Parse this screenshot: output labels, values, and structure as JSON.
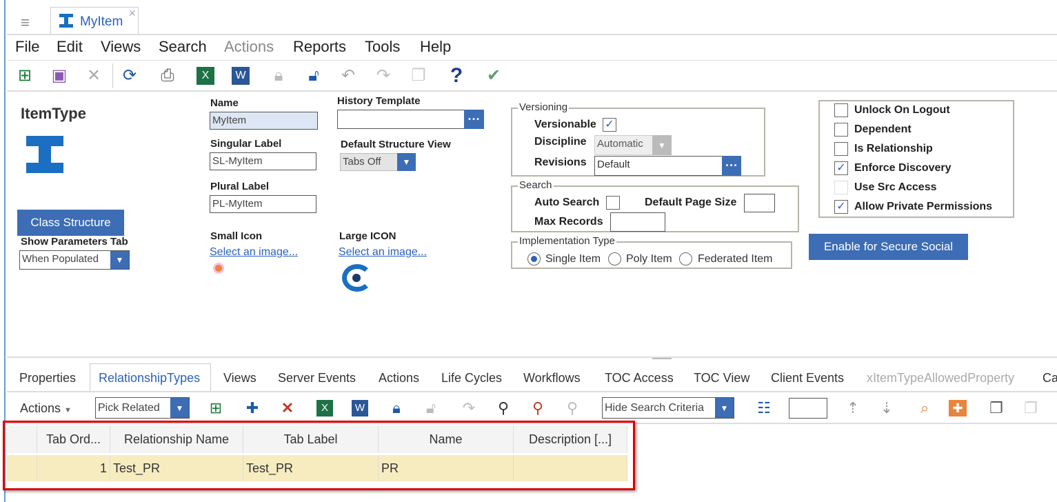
{
  "tab": {
    "title": "MyItem"
  },
  "menu": [
    "File",
    "Edit",
    "Views",
    "Search",
    "Actions",
    "Reports",
    "Tools",
    "Help"
  ],
  "form": {
    "heading": "ItemType",
    "class_structure": "Class Structure",
    "show_params_label": "Show Parameters Tab",
    "show_params_value": "When Populated",
    "name_label": "Name",
    "name_value": "MyItem",
    "singular_label": "Singular Label",
    "singular_value": "SL-MyItem",
    "plural_label": "Plural Label",
    "plural_value": "PL-MyItem",
    "small_icon_label": "Small Icon",
    "small_icon_link": "Select an image...",
    "history_label": "History Template",
    "history_value": "",
    "structure_label": "Default Structure View",
    "structure_value": "Tabs Off",
    "large_icon_label": "Large ICON",
    "large_icon_link": "Select an image...",
    "versioning": {
      "title": "Versioning",
      "versionable": "Versionable",
      "versionable_checked": true,
      "discipline": "Discipline",
      "discipline_value": "Automatic",
      "revisions": "Revisions",
      "revisions_value": "Default"
    },
    "search": {
      "title": "Search",
      "auto_search": "Auto Search",
      "auto_search_checked": false,
      "page_size": "Default Page Size",
      "page_size_value": "",
      "max_records": "Max Records",
      "max_records_value": ""
    },
    "impl": {
      "title": "Implementation Type",
      "options": [
        "Single Item",
        "Poly Item",
        "Federated Item"
      ],
      "selected": "Single Item"
    },
    "checks": [
      {
        "label": "Unlock On Logout",
        "checked": false
      },
      {
        "label": "Dependent",
        "checked": false
      },
      {
        "label": "Is Relationship",
        "checked": false
      },
      {
        "label": "Enforce Discovery",
        "checked": true
      },
      {
        "label": "Use Src Access",
        "checked": false
      },
      {
        "label": "Allow Private Permissions",
        "checked": true
      }
    ],
    "secure_social": "Enable for Secure Social"
  },
  "tabs": [
    "Properties",
    "RelationshipTypes",
    "Views",
    "Server Events",
    "Actions",
    "Life Cycles",
    "Workflows",
    "TOC Access",
    "TOC View",
    "Client Events",
    "xItemTypeAllowedProperty",
    "Ca"
  ],
  "active_tab": "RelationshipTypes",
  "rel_toolbar": {
    "actions": "Actions",
    "pick": "Pick Related",
    "criteria": "Hide Search Criteria",
    "page_value": ""
  },
  "grid": {
    "headers": [
      "Tab Ord...",
      "Relationship Name",
      "Tab Label",
      "Name",
      "Description [...]"
    ],
    "rows": [
      [
        "1",
        "Test_PR",
        "Test_PR",
        "PR",
        ""
      ]
    ]
  },
  "colors": {
    "accent": "#3d6db4",
    "highlight": "#f7ecc0",
    "annotation": "#e00000"
  }
}
